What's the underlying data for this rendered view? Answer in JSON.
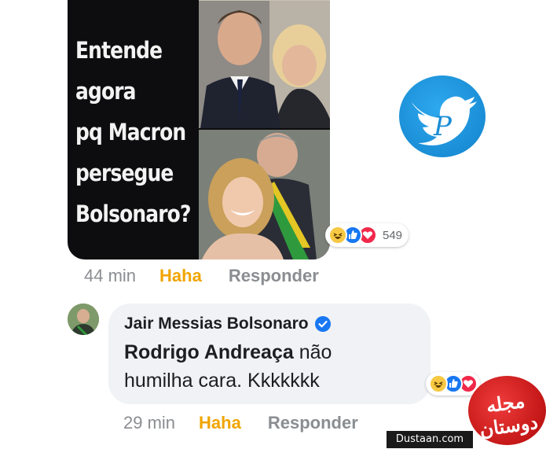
{
  "meme": {
    "lines": [
      "Entende",
      "agora",
      "pq Macron",
      "persegue",
      "Bolsonaro?"
    ]
  },
  "post": {
    "reactions": {
      "icons": [
        "haha-icon",
        "like-icon",
        "love-icon"
      ],
      "count": "549"
    },
    "time": "44 min",
    "haha_label": "Haha",
    "reply_label": "Responder"
  },
  "comment": {
    "author": "Jair Messias Bolsonaro",
    "verified": true,
    "mention": "Rodrigo Andreaça",
    "text_after_mention": " não",
    "text_line2": "humilha cara. Kkkkkkk",
    "reactions": {
      "icons": [
        "haha-icon",
        "like-icon",
        "love-icon"
      ]
    },
    "time": "29 min",
    "haha_label": "Haha",
    "reply_label": "Responder"
  },
  "watermark": {
    "site": "Dustaan.com",
    "logo_text": "مجله دوستان"
  },
  "colors": {
    "haha": "#f7c844",
    "like": "#1877f2",
    "love": "#f0284a",
    "haha_text": "#f0a500",
    "muted": "#8a8d91",
    "bubble": "#f0f2f5"
  }
}
